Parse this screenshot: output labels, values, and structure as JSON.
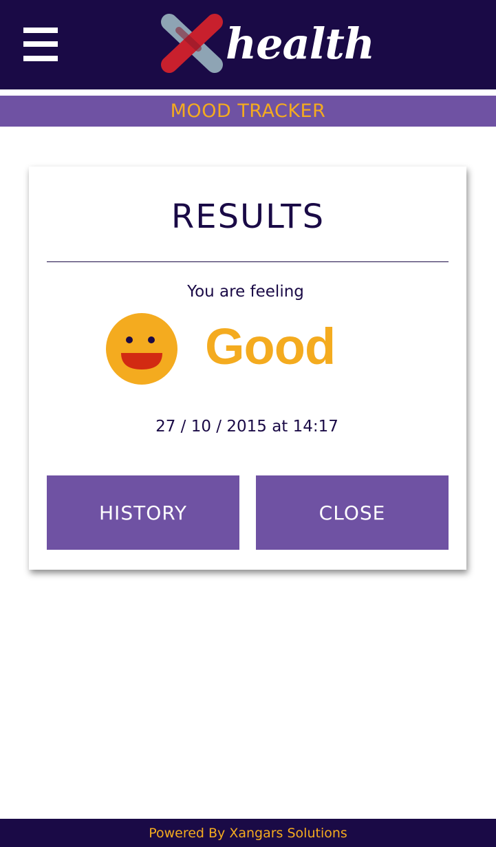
{
  "header": {
    "menu_icon": "hamburger-menu-icon",
    "logo_text": "health",
    "logo_mark": "x-cross-logo",
    "colors": {
      "background": "#1a0a46",
      "logo_red": "#c8202d",
      "logo_grey": "#8ea4b4"
    }
  },
  "subheader": {
    "title": "MOOD TRACKER",
    "colors": {
      "background": "#6f52a3",
      "text": "#f4ab1f"
    }
  },
  "results_card": {
    "title": "RESULTS",
    "feeling_label": "You are feeling",
    "mood": {
      "label": "Good",
      "icon": "happy-face-icon",
      "color": "#f4ab1f",
      "mouth_color": "#d22a12"
    },
    "timestamp": "27 / 10 / 2015 at 14:17",
    "buttons": {
      "history_label": "HISTORY",
      "close_label": "CLOSE"
    }
  },
  "footer": {
    "text": "Powered By Xangars Solutions"
  }
}
